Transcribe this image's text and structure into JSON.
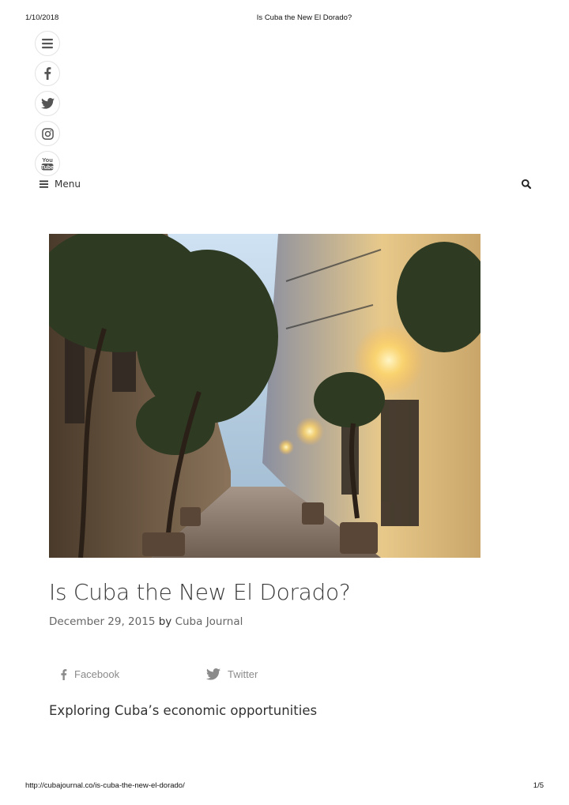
{
  "print_header": {
    "date": "1/10/2018",
    "title": "Is Cuba the New El Dorado?"
  },
  "print_footer": {
    "url": "http://cubajournal.co/is-cuba-the-new-el-dorado/",
    "page": "1/5"
  },
  "social_rail": [
    {
      "icon": "hamburger-menu-icon"
    },
    {
      "icon": "facebook-icon"
    },
    {
      "icon": "twitter-icon"
    },
    {
      "icon": "instagram-icon"
    },
    {
      "icon": "youtube-icon",
      "logo_text": "You Tube"
    }
  ],
  "nav": {
    "menu_label": "Menu",
    "menu_icon": "hamburger-menu-icon",
    "search_icon": "search-icon"
  },
  "post": {
    "title": "Is Cuba the New El Dorado?",
    "date": "December 29, 2015",
    "by": "by",
    "author": "Cuba Journal",
    "intro": "Exploring Cuba’s economic opportunities"
  },
  "share": {
    "facebook_label": "Facebook",
    "twitter_label": "Twitter"
  },
  "colors": {
    "text_dark": "#3a3a3a",
    "text_muted": "#8a8a8a",
    "meta": "#666666"
  }
}
